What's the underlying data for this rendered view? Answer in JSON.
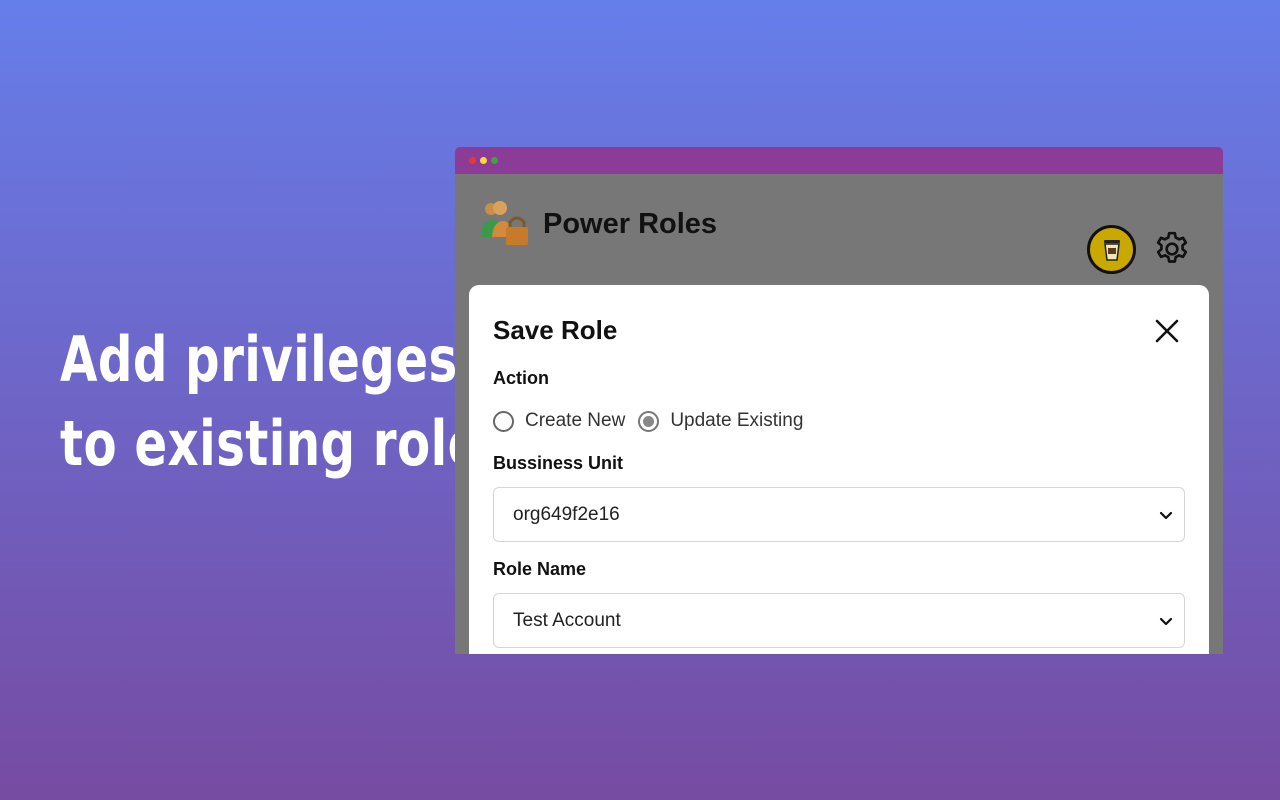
{
  "hero": {
    "line1": "Add privileges",
    "line2": "to existing role"
  },
  "window": {
    "dots": [
      "#e53935",
      "#fdd835",
      "#43a047"
    ],
    "title_bar_color": "#8a3c96"
  },
  "app": {
    "title": "Power Roles",
    "logo_icon": "users-lock-icon",
    "coffee_icon": "coffee-cup-icon",
    "settings_icon": "gear-icon"
  },
  "modal": {
    "title": "Save Role",
    "close_icon": "close-icon",
    "action_label": "Action",
    "action_options": [
      {
        "label": "Create New",
        "checked": false
      },
      {
        "label": "Update Existing",
        "checked": true
      }
    ],
    "business_unit_label": "Bussiness Unit",
    "business_unit_value": "org649f2e16",
    "role_name_label": "Role Name",
    "role_name_value": "Test Account"
  },
  "colors": {
    "accent_yellow": "#c9a800",
    "title_bar": "#8a3c96",
    "overlay": "#777777"
  }
}
